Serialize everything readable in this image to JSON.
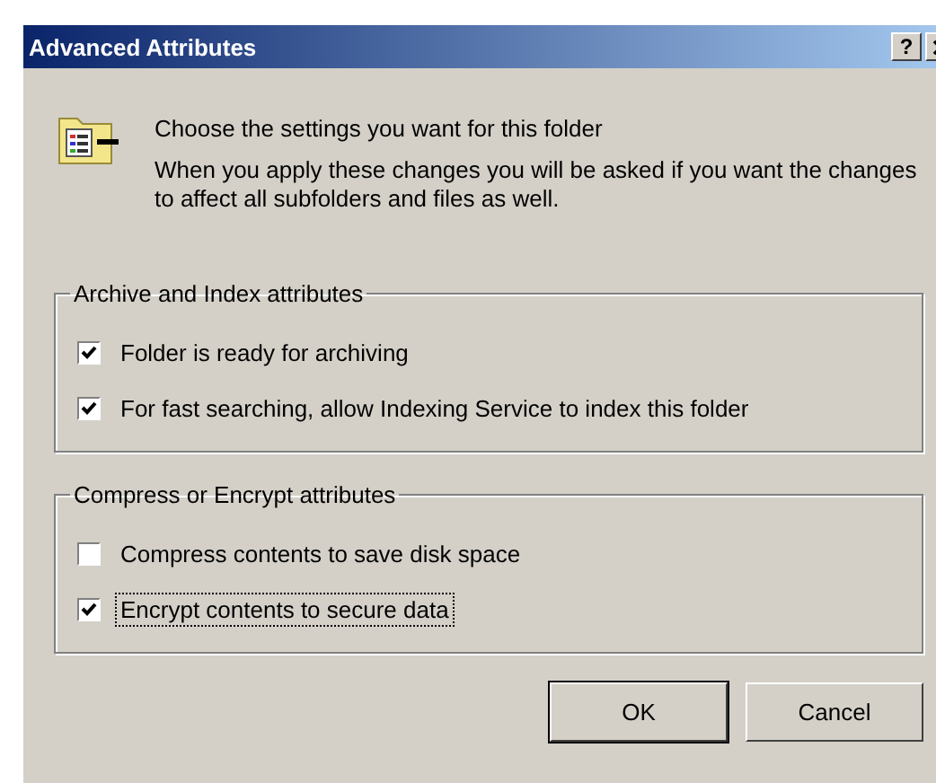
{
  "window": {
    "title": "Advanced Attributes",
    "help_button": "?"
  },
  "intro": {
    "heading": "Choose the settings you want for this folder",
    "text": "When you apply these changes you will be asked if you want the changes to affect all subfolders and files as well."
  },
  "groups": [
    {
      "title": "Archive and Index attributes",
      "options": [
        {
          "label": "Folder is ready for archiving",
          "checked": true,
          "focused": false
        },
        {
          "label": "For fast searching, allow Indexing Service to index this folder",
          "checked": true,
          "focused": false
        }
      ]
    },
    {
      "title": "Compress or Encrypt attributes",
      "options": [
        {
          "label": "Compress contents to save disk space",
          "checked": false,
          "focused": false
        },
        {
          "label": "Encrypt contents to secure data",
          "checked": true,
          "focused": true
        }
      ]
    }
  ],
  "buttons": [
    {
      "label": "OK",
      "default": true
    },
    {
      "label": "Cancel",
      "default": false
    }
  ]
}
